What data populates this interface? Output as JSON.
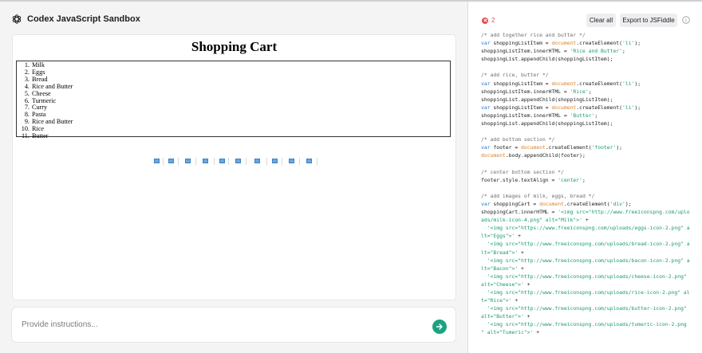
{
  "app": {
    "title": "Codex JavaScript Sandbox",
    "logo_icon": "openai-logo-icon"
  },
  "preview": {
    "heading": "Shopping Cart",
    "items": [
      "Milk",
      "Eggs",
      "Bread",
      "Rice and Butter",
      "Cheese",
      "Turmeric",
      "Curry",
      "Pasta",
      "Rice and Butter",
      "Rice",
      "Butter"
    ],
    "broken_image_count": 10
  },
  "instructions": {
    "placeholder": "Provide instructions...",
    "value": ""
  },
  "toolbar": {
    "error_count": "2",
    "clear_label": "Clear all",
    "export_label": "Export to JSFiddle",
    "info_icon": "info-icon"
  },
  "colors": {
    "accent": "#19a37f",
    "error": "#e44a4a",
    "keyword": "#2c6fd9",
    "string": "#1a9a73",
    "object": "#d9822b"
  },
  "code_lines": [
    [
      {
        "t": "/* add together rice and butter */",
        "c": "comment"
      }
    ],
    [
      {
        "t": "var ",
        "c": "kw"
      },
      {
        "t": "shoppingListItem = ",
        "c": "plain"
      },
      {
        "t": "document",
        "c": "obj"
      },
      {
        "t": ".createElement(",
        "c": "plain"
      },
      {
        "t": "'li'",
        "c": "str"
      },
      {
        "t": ");",
        "c": "plain"
      }
    ],
    [
      {
        "t": "shoppingListItem.innerHTML = ",
        "c": "plain"
      },
      {
        "t": "'Rice and Butter'",
        "c": "str"
      },
      {
        "t": ";",
        "c": "plain"
      }
    ],
    [
      {
        "t": "shoppingList.appendChild(shoppingListItem);",
        "c": "plain"
      }
    ],
    [],
    [
      {
        "t": "/* add rice, butter */",
        "c": "comment"
      }
    ],
    [
      {
        "t": "var ",
        "c": "kw"
      },
      {
        "t": "shoppingListItem = ",
        "c": "plain"
      },
      {
        "t": "document",
        "c": "obj"
      },
      {
        "t": ".createElement(",
        "c": "plain"
      },
      {
        "t": "'li'",
        "c": "str"
      },
      {
        "t": ");",
        "c": "plain"
      }
    ],
    [
      {
        "t": "shoppingListItem.innerHTML = ",
        "c": "plain"
      },
      {
        "t": "'Rice'",
        "c": "str"
      },
      {
        "t": ";",
        "c": "plain"
      }
    ],
    [
      {
        "t": "shoppingList.appendChild(shoppingListItem);",
        "c": "plain"
      }
    ],
    [
      {
        "t": "var ",
        "c": "kw"
      },
      {
        "t": "shoppingListItem = ",
        "c": "plain"
      },
      {
        "t": "document",
        "c": "obj"
      },
      {
        "t": ".createElement(",
        "c": "plain"
      },
      {
        "t": "'li'",
        "c": "str"
      },
      {
        "t": ");",
        "c": "plain"
      }
    ],
    [
      {
        "t": "shoppingListItem.innerHTML = ",
        "c": "plain"
      },
      {
        "t": "'Butter'",
        "c": "str"
      },
      {
        "t": ";",
        "c": "plain"
      }
    ],
    [
      {
        "t": "shoppingList.appendChild(shoppingListItem);",
        "c": "plain"
      }
    ],
    [],
    [
      {
        "t": "/* add bottom section */",
        "c": "comment"
      }
    ],
    [
      {
        "t": "var ",
        "c": "kw"
      },
      {
        "t": "footer = ",
        "c": "plain"
      },
      {
        "t": "document",
        "c": "obj"
      },
      {
        "t": ".createElement(",
        "c": "plain"
      },
      {
        "t": "'footer'",
        "c": "str"
      },
      {
        "t": ");",
        "c": "plain"
      }
    ],
    [
      {
        "t": "document",
        "c": "obj"
      },
      {
        "t": ".body.appendChild(footer);",
        "c": "plain"
      }
    ],
    [],
    [
      {
        "t": "/* center bottom section */",
        "c": "comment"
      }
    ],
    [
      {
        "t": "footer.style.textAlign = ",
        "c": "plain"
      },
      {
        "t": "'center'",
        "c": "str"
      },
      {
        "t": ";",
        "c": "plain"
      }
    ],
    [],
    [
      {
        "t": "/* add images of milk, eggs, bread */",
        "c": "comment"
      }
    ],
    [
      {
        "t": "var ",
        "c": "kw"
      },
      {
        "t": "shoppingCart = ",
        "c": "plain"
      },
      {
        "t": "document",
        "c": "obj"
      },
      {
        "t": ".createElement(",
        "c": "plain"
      },
      {
        "t": "'div'",
        "c": "str"
      },
      {
        "t": ");",
        "c": "plain"
      }
    ],
    [
      {
        "t": "shoppingCart.innerHTML = ",
        "c": "plain"
      },
      {
        "t": "'<img src=\"http://www.freeiconspng.com/uplo",
        "c": "str"
      }
    ],
    [
      {
        "t": "ads/milk-icon-4.png\" alt=\"Milk\">'",
        "c": "str"
      },
      {
        "t": " +",
        "c": "plain"
      }
    ],
    [
      {
        "t": "  '<img src=\"https://www.freeiconspng.com/uploads/eggs-icon-2.png\" a",
        "c": "str"
      }
    ],
    [
      {
        "t": "lt=\"Eggs\">'",
        "c": "str"
      },
      {
        "t": " +",
        "c": "plain"
      }
    ],
    [
      {
        "t": "  '<img src=\"http://www.freeiconspng.com/uploads/bread-icon-2.png\" a",
        "c": "str"
      }
    ],
    [
      {
        "t": "lt=\"Bread\">'",
        "c": "str"
      },
      {
        "t": " +",
        "c": "plain"
      }
    ],
    [
      {
        "t": "  '<img src=\"http://www.freeiconspng.com/uploads/bacon-icon-2.png\" a",
        "c": "str"
      }
    ],
    [
      {
        "t": "lt=\"Bacon\">'",
        "c": "str"
      },
      {
        "t": " +",
        "c": "plain"
      }
    ],
    [
      {
        "t": "  '<img src=\"http://www.freeiconspng.com/uploads/cheese-icon-2.png\"",
        "c": "str"
      }
    ],
    [
      {
        "t": "alt=\"Cheese\">'",
        "c": "str"
      },
      {
        "t": " +",
        "c": "plain"
      }
    ],
    [
      {
        "t": "  '<img src=\"http://www.freeiconspng.com/uploads/rice-icon-2.png\" al",
        "c": "str"
      }
    ],
    [
      {
        "t": "t=\"Rice\">'",
        "c": "str"
      },
      {
        "t": " +",
        "c": "plain"
      }
    ],
    [
      {
        "t": "  '<img src=\"http://www.freeiconspng.com/uploads/butter-icon-2.png\"",
        "c": "str"
      }
    ],
    [
      {
        "t": "alt=\"Butter\">'",
        "c": "str"
      },
      {
        "t": " +",
        "c": "plain"
      }
    ],
    [
      {
        "t": "  '<img src=\"http://www.freeiconspng.com/uploads/tumeric-icon-2.png",
        "c": "str"
      }
    ],
    [
      {
        "t": "\" alt=\"Tumeric\">'",
        "c": "str"
      },
      {
        "t": " +",
        "c": "plain"
      }
    ]
  ]
}
